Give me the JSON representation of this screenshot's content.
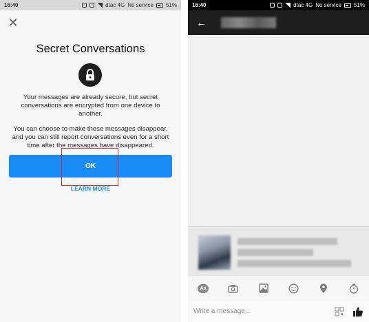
{
  "left_screen": {
    "status": {
      "time": "16:40",
      "carrier": "dtac 4G",
      "service": "No service",
      "battery": "51%"
    },
    "dialog": {
      "close_glyph": "✕",
      "title": "Secret Conversations",
      "icon": "lock-icon",
      "paragraph1": "Your messages are already secure, but secret conversations are encrypted from one device to another.",
      "paragraph2": "You can choose to make these messages disappear, and you can still report conversations even for a short time after the messages have disappeared.",
      "ok_label": "OK",
      "learn_more_label": "LEARN MORE",
      "highlight_color": "#d7272a"
    }
  },
  "right_screen": {
    "status": {
      "time": "16:40",
      "carrier": "dtac 4G",
      "service": "No service",
      "battery": "51%"
    },
    "appbar": {
      "back_glyph": "←",
      "contact_name_blurred": true
    },
    "toolbar": {
      "text_style_label": "Aa",
      "icons": [
        "text-style-icon",
        "camera-icon",
        "image-icon",
        "emoji-icon",
        "location-icon",
        "timer-icon"
      ]
    },
    "composer": {
      "placeholder": "Write a message..."
    }
  },
  "colors": {
    "accent": "#1a8cf7",
    "dark": "#1e1e1e"
  }
}
